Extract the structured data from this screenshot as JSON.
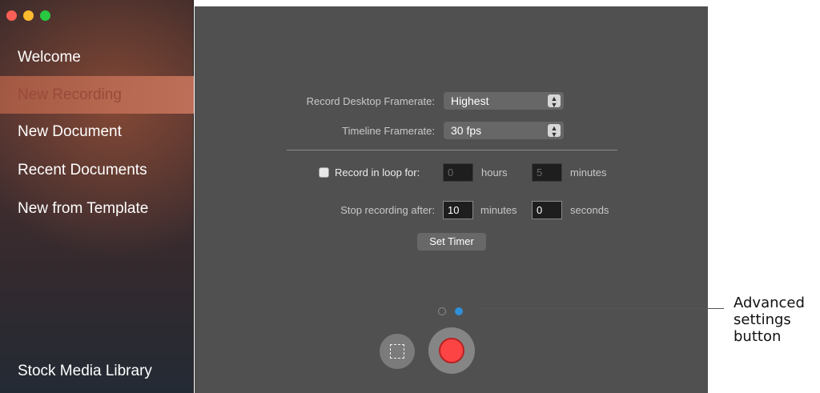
{
  "sidebar": {
    "items": [
      {
        "label": "Welcome"
      },
      {
        "label": "New Recording"
      },
      {
        "label": "New Document"
      },
      {
        "label": "Recent Documents"
      },
      {
        "label": "New from Template"
      }
    ],
    "footer": {
      "label": "Stock Media Library"
    }
  },
  "settings": {
    "desktop_framerate": {
      "label": "Record Desktop Framerate:",
      "value": "Highest"
    },
    "timeline_framerate": {
      "label": "Timeline Framerate:",
      "value": "30 fps"
    },
    "loop": {
      "label": "Record in loop for:",
      "hours_value": "0",
      "hours_unit": "hours",
      "minutes_value": "5",
      "minutes_unit": "minutes"
    },
    "stop": {
      "label": "Stop recording after:",
      "minutes_value": "10",
      "minutes_unit": "minutes",
      "seconds_value": "0",
      "seconds_unit": "seconds"
    },
    "set_timer_label": "Set Timer"
  },
  "annotation": {
    "text": "Advanced settings button"
  },
  "colors": {
    "accent": "#2f8fd8",
    "record": "#fc4445"
  }
}
